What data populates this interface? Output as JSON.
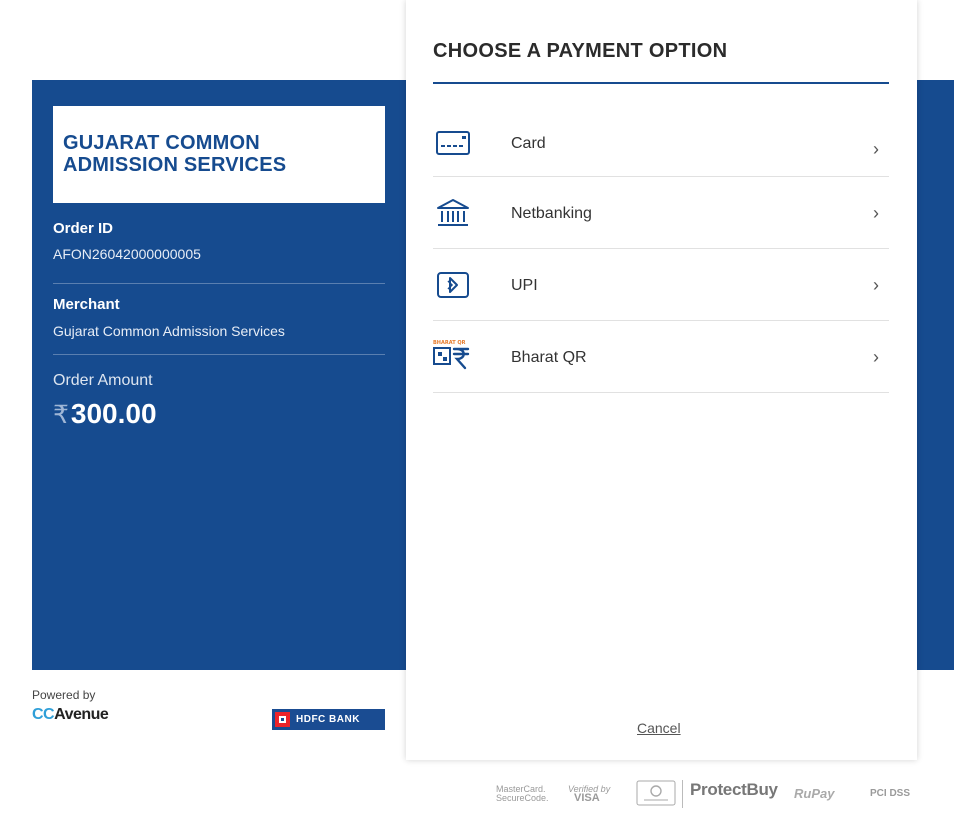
{
  "merchant_box": {
    "line1": "GUJARAT COMMON",
    "line2": "ADMISSION SERVICES"
  },
  "order": {
    "id_label": "Order ID",
    "id_value": "AFON26042000000005"
  },
  "merchant": {
    "label": "Merchant",
    "value": "Gujarat Common Admission Services"
  },
  "amount": {
    "label": "Order Amount",
    "currency": "₹",
    "value": "300.00"
  },
  "footer_left": {
    "powered_by": "Powered by",
    "cc": "CC",
    "avenue": "Avenue",
    "bank": "HDFC BANK"
  },
  "payment": {
    "title": "CHOOSE A PAYMENT OPTION",
    "options": [
      {
        "label": "Card",
        "icon": "card-icon"
      },
      {
        "label": "Netbanking",
        "icon": "bank-icon"
      },
      {
        "label": "UPI",
        "icon": "upi-icon"
      },
      {
        "label": "Bharat QR",
        "icon": "bharat-qr-icon",
        "icon_text": "BHARAT QR"
      }
    ],
    "chevron": "›",
    "cancel": "Cancel"
  },
  "security_badges": {
    "mastercard": [
      "MasterCard.",
      "SecureCode."
    ],
    "visa": [
      "Verified by",
      "VISA"
    ],
    "protectbuy": "ProtectBuy",
    "rupay": "RuPay",
    "pci": "PCI DSS"
  },
  "colors": {
    "brand_blue": "#164b8f",
    "cc_blue": "#2f9fd8",
    "hdfc_red": "#ed232a"
  }
}
